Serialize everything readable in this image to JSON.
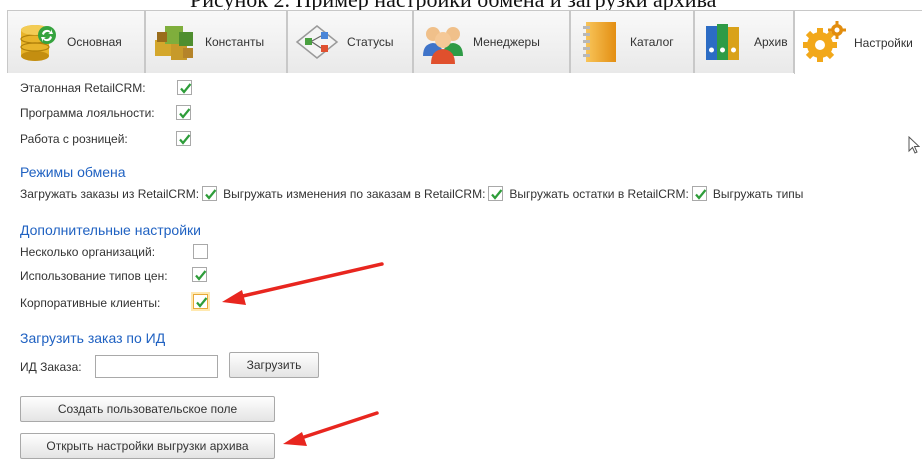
{
  "header_caption": "Рисунок 2. Пример настройки обмена и загрузки архива",
  "tabs": [
    {
      "label": "Основная",
      "icon": "database-sync-icon"
    },
    {
      "label": "Константы",
      "icon": "cubes-icon"
    },
    {
      "label": "Статусы",
      "icon": "flowchart-icon"
    },
    {
      "label": "Менеджеры",
      "icon": "users-icon"
    },
    {
      "label": "Каталог",
      "icon": "notebook-icon"
    },
    {
      "label": "Архив",
      "icon": "binders-icon"
    },
    {
      "label": "Настройки",
      "icon": "gears-icon",
      "active": true
    }
  ],
  "top_options": [
    {
      "label": "Эталонная RetailCRM:",
      "checked": true
    },
    {
      "label": "Программа лояльности:",
      "checked": true
    },
    {
      "label": "Работа с розницей:",
      "checked": true
    }
  ],
  "exchange": {
    "title": "Режимы обмена",
    "items": [
      {
        "label": "Загружать заказы  из RetailCRM:",
        "checked": true
      },
      {
        "label": "Выгружать изменения по заказам в RetailCRM:",
        "checked": true
      },
      {
        "label": "Выгружать остатки в RetailCRM:",
        "checked": true
      },
      {
        "label": "Выгружать типы",
        "checked": false
      }
    ]
  },
  "additional": {
    "title": "Дополнительные настройки",
    "items": [
      {
        "label": "Несколько организаций:",
        "checked": false
      },
      {
        "label": "Использование типов цен:",
        "checked": true
      },
      {
        "label": "Корпоративные клиенты:",
        "checked": true
      }
    ]
  },
  "load_order": {
    "title": "Загрузить заказ по ИД",
    "field_label": "ИД Заказа:",
    "field_value": "",
    "load_button": "Загрузить"
  },
  "buttons": {
    "create_field": "Создать пользовательское поле",
    "open_archive_settings": "Открыть настройки выгрузки архива"
  },
  "colors": {
    "section_title": "#2062c2",
    "checkmark": "#2e9d3a",
    "annotation_arrow": "#e8261f"
  }
}
